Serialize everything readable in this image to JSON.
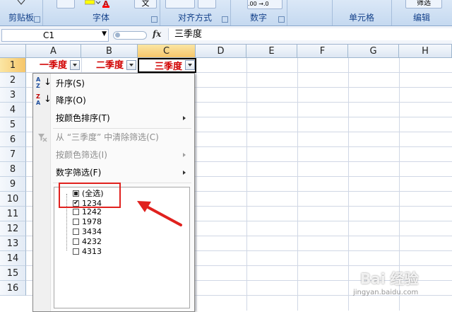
{
  "ribbon": {
    "groups": [
      "剪贴板",
      "字体",
      "对齐方式",
      "数字",
      "单元格",
      "编辑"
    ],
    "top_partial": [
      "文",
      "筛选"
    ],
    "number_formats": [
      ".00",
      "→.0"
    ]
  },
  "formula_bar": {
    "name_box": "C1",
    "fx": "fx",
    "content": "三季度"
  },
  "columns": [
    "A",
    "B",
    "C",
    "D",
    "E",
    "F",
    "G",
    "H"
  ],
  "rows": [
    "1",
    "2",
    "3",
    "4",
    "5",
    "6",
    "7",
    "8",
    "9",
    "10",
    "11",
    "12",
    "13",
    "14",
    "15",
    "16"
  ],
  "cells": {
    "a1": "一季度",
    "b1": "二季度",
    "c1": "三季度"
  },
  "filter_menu": {
    "sort_asc": "升序(S)",
    "sort_desc": "降序(O)",
    "sort_by_color": "按颜色排序(T)",
    "clear_filter": "从 “三季度” 中清除筛选(C)",
    "filter_by_color": "按颜色筛选(I)",
    "number_filters": "数字筛选(F)",
    "icon_asc": [
      "A",
      "Z"
    ],
    "icon_desc": [
      "Z",
      "A"
    ],
    "checklist": [
      {
        "label": "(全选)",
        "state": "partial"
      },
      {
        "label": "1234",
        "state": "checked"
      },
      {
        "label": "1242",
        "state": "unchecked"
      },
      {
        "label": "1978",
        "state": "unchecked"
      },
      {
        "label": "3434",
        "state": "unchecked"
      },
      {
        "label": "4232",
        "state": "unchecked"
      },
      {
        "label": "4313",
        "state": "unchecked"
      }
    ],
    "check_mark": "✔"
  },
  "annotation": {
    "highlight_color": "#e0211e",
    "arrow_color": "#e0211e"
  },
  "watermark": {
    "line1": "Bai 经验",
    "line2": "jingyan.baidu.com"
  }
}
